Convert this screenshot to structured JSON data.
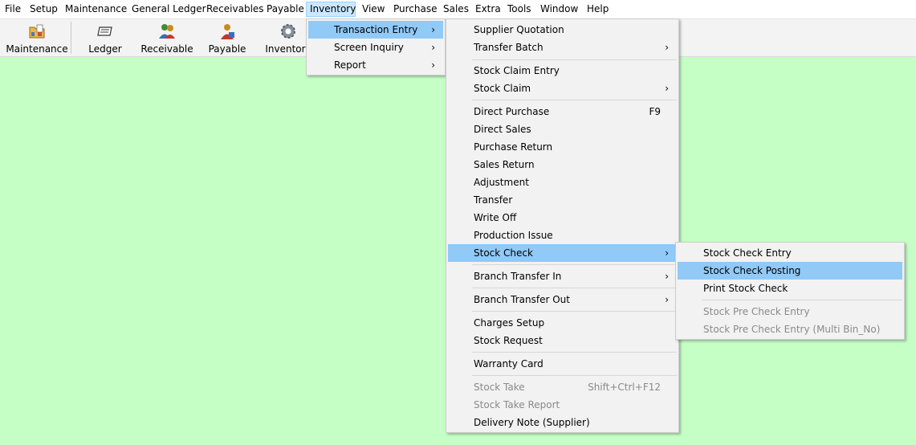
{
  "menubar": {
    "items": [
      "File",
      "Setup",
      "Maintenance",
      "General Ledger",
      "Receivables",
      "Payable",
      "Inventory",
      "View",
      "Purchase",
      "Sales",
      "Extra",
      "Tools",
      "Window",
      "Help"
    ],
    "active": "Inventory"
  },
  "toolbar": {
    "buttons": [
      {
        "label": "Maintenance",
        "icon": "folder-icon"
      },
      {
        "label": "Ledger",
        "icon": "ledger-icon"
      },
      {
        "label": "Receivable",
        "icon": "receivable-people-icon"
      },
      {
        "label": "Payable",
        "icon": "payable-person-icon"
      },
      {
        "label": "Inventory",
        "icon": "gear-icon"
      }
    ]
  },
  "inventory_menu": {
    "items": [
      {
        "label": "Transaction Entry",
        "submenu": true,
        "highlighted": true
      },
      {
        "label": "Screen Inquiry",
        "submenu": true
      },
      {
        "label": "Report",
        "submenu": true
      }
    ]
  },
  "transaction_menu": {
    "items": [
      {
        "label": "Supplier Quotation"
      },
      {
        "label": "Transfer Batch",
        "submenu": true
      },
      {
        "label": "Stock Claim Entry"
      },
      {
        "label": "Stock Claim",
        "submenu": true
      },
      {
        "label": "Direct Purchase",
        "shortcut": "F9"
      },
      {
        "label": "Direct Sales"
      },
      {
        "label": "Purchase Return"
      },
      {
        "label": "Sales Return"
      },
      {
        "label": "Adjustment"
      },
      {
        "label": "Transfer"
      },
      {
        "label": "Write Off"
      },
      {
        "label": "Production Issue"
      },
      {
        "label": "Stock Check",
        "submenu": true,
        "highlighted": true
      },
      {
        "label": "Branch Transfer In",
        "submenu": true
      },
      {
        "label": "Branch Transfer Out",
        "submenu": true
      },
      {
        "label": "Charges Setup"
      },
      {
        "label": "Stock Request"
      },
      {
        "label": "Warranty Card"
      },
      {
        "label": "Stock Take",
        "shortcut": "Shift+Ctrl+F12",
        "disabled": true
      },
      {
        "label": "Stock Take Report",
        "disabled": true
      },
      {
        "label": "Delivery Note (Supplier)"
      }
    ]
  },
  "stock_check_menu": {
    "items": [
      {
        "label": "Stock Check Entry"
      },
      {
        "label": "Stock Check Posting",
        "highlighted": true
      },
      {
        "label": "Print Stock Check"
      },
      {
        "label": "Stock Pre Check Entry",
        "disabled": true
      },
      {
        "label": "Stock Pre Check Entry (Multi Bin_No)",
        "disabled": true
      }
    ]
  },
  "colors": {
    "workspace": "#c6ffc6",
    "menu_background": "#f2f2f2",
    "highlight": "#91c9f7",
    "disabled_text": "#8a8a8a"
  }
}
